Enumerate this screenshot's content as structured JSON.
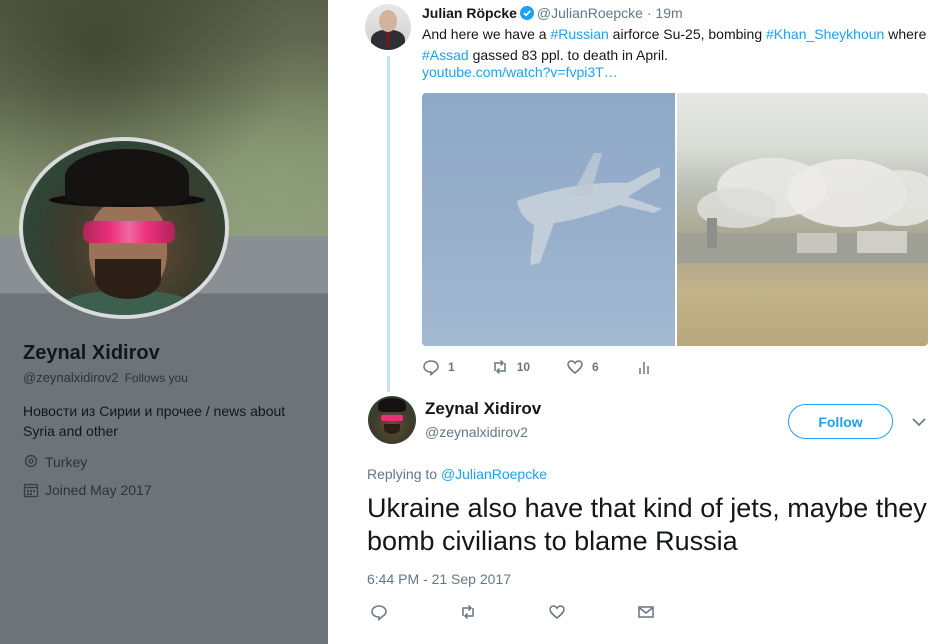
{
  "colors": {
    "accent": "#1da1f2",
    "thread_line": "#c4e2f5",
    "muted": "#657786"
  },
  "profile": {
    "name": "Zeynal Xidirov",
    "handle": "@zeynalxidirov2",
    "follows_you": "Follows you",
    "bio": "Новости из Сирии и прочее / news about Syria and other",
    "location": "Turkey",
    "joined": "Joined May 2017",
    "icons": {
      "location": "location-pin-icon",
      "joined": "calendar-icon"
    }
  },
  "quoted_tweet": {
    "author_name": "Julian Röpcke",
    "handle": "@JulianRoepcke",
    "separator": "·",
    "time": "19m",
    "text_parts": {
      "t1": "And here we have a ",
      "h1": "#Russian",
      "t2": " airforce Su-25, bombing ",
      "h2": "#Khan_Sheykhoun",
      "t3": " where ",
      "h3": "#Assad",
      "t4": " gassed 83 ppl. to death in April."
    },
    "link": "youtube.com/watch?v=fvpi3T…",
    "actions": {
      "replies": "1",
      "retweets": "10",
      "likes": "6"
    }
  },
  "reply_tweet": {
    "author_name": "Zeynal Xidirov",
    "handle": "@zeynalxidirov2",
    "follow_label": "Follow",
    "replying_to_label": "Replying to ",
    "replying_to_handle": "@JulianRoepcke",
    "text": "Ukraine also have that kind of jets, maybe they bomb civilians to blame Russia",
    "timestamp": "6:44 PM - 21 Sep 2017"
  }
}
